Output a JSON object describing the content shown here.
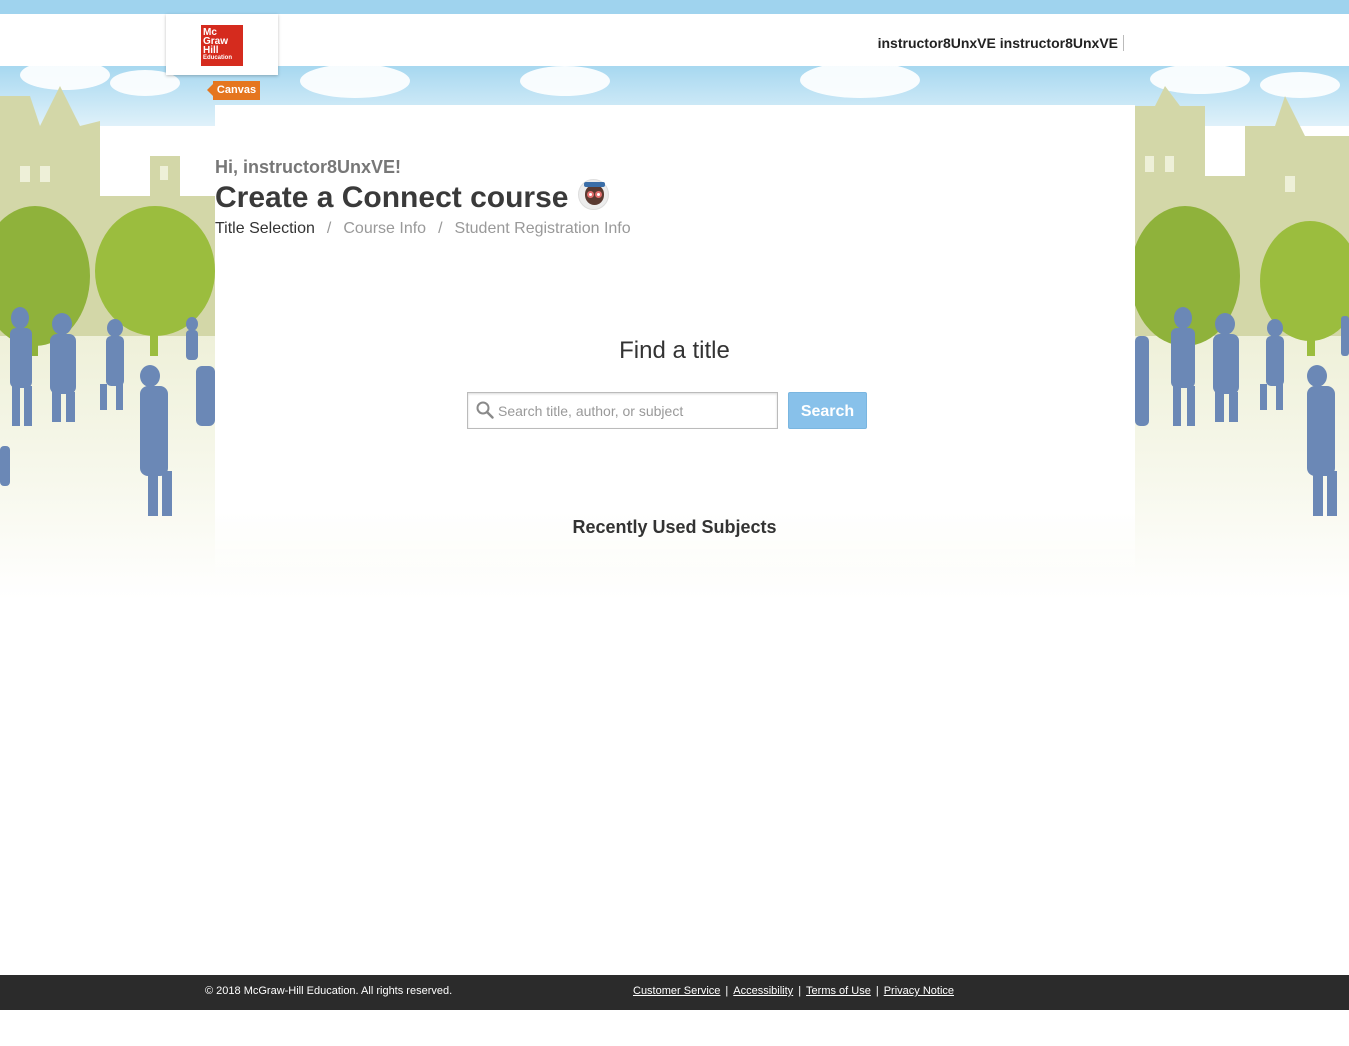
{
  "header": {
    "logo_lines": [
      "Mc",
      "Graw",
      "Hill"
    ],
    "logo_sub": "Education",
    "lms_tag": "Canvas",
    "user_name": "instructor8UnxVE instructor8UnxVE"
  },
  "main": {
    "greeting": "Hi, instructor8UnxVE!",
    "title": "Create a Connect course",
    "breadcrumbs": [
      {
        "label": "Title Selection",
        "active": true
      },
      {
        "label": "Course Info",
        "active": false
      },
      {
        "label": "Student Registration Info",
        "active": false
      }
    ],
    "find_title": "Find a title",
    "search": {
      "placeholder": "Search title, author, or subject",
      "value": "",
      "button_label": "Search"
    },
    "recent_heading": "Recently Used Subjects"
  },
  "footer": {
    "copyright": "© 2018 McGraw-Hill Education. All rights reserved.",
    "links": [
      "Customer Service",
      "Accessibility",
      "Terms of Use",
      "Privacy Notice"
    ]
  },
  "colors": {
    "brand_red": "#d52b1e",
    "canvas_orange": "#e5761f",
    "search_button": "#88c1ea",
    "footer_bg": "#2b2b2b"
  },
  "icons": [
    "search-icon",
    "owl-mascot-icon",
    "mcgraw-hill-logo"
  ]
}
